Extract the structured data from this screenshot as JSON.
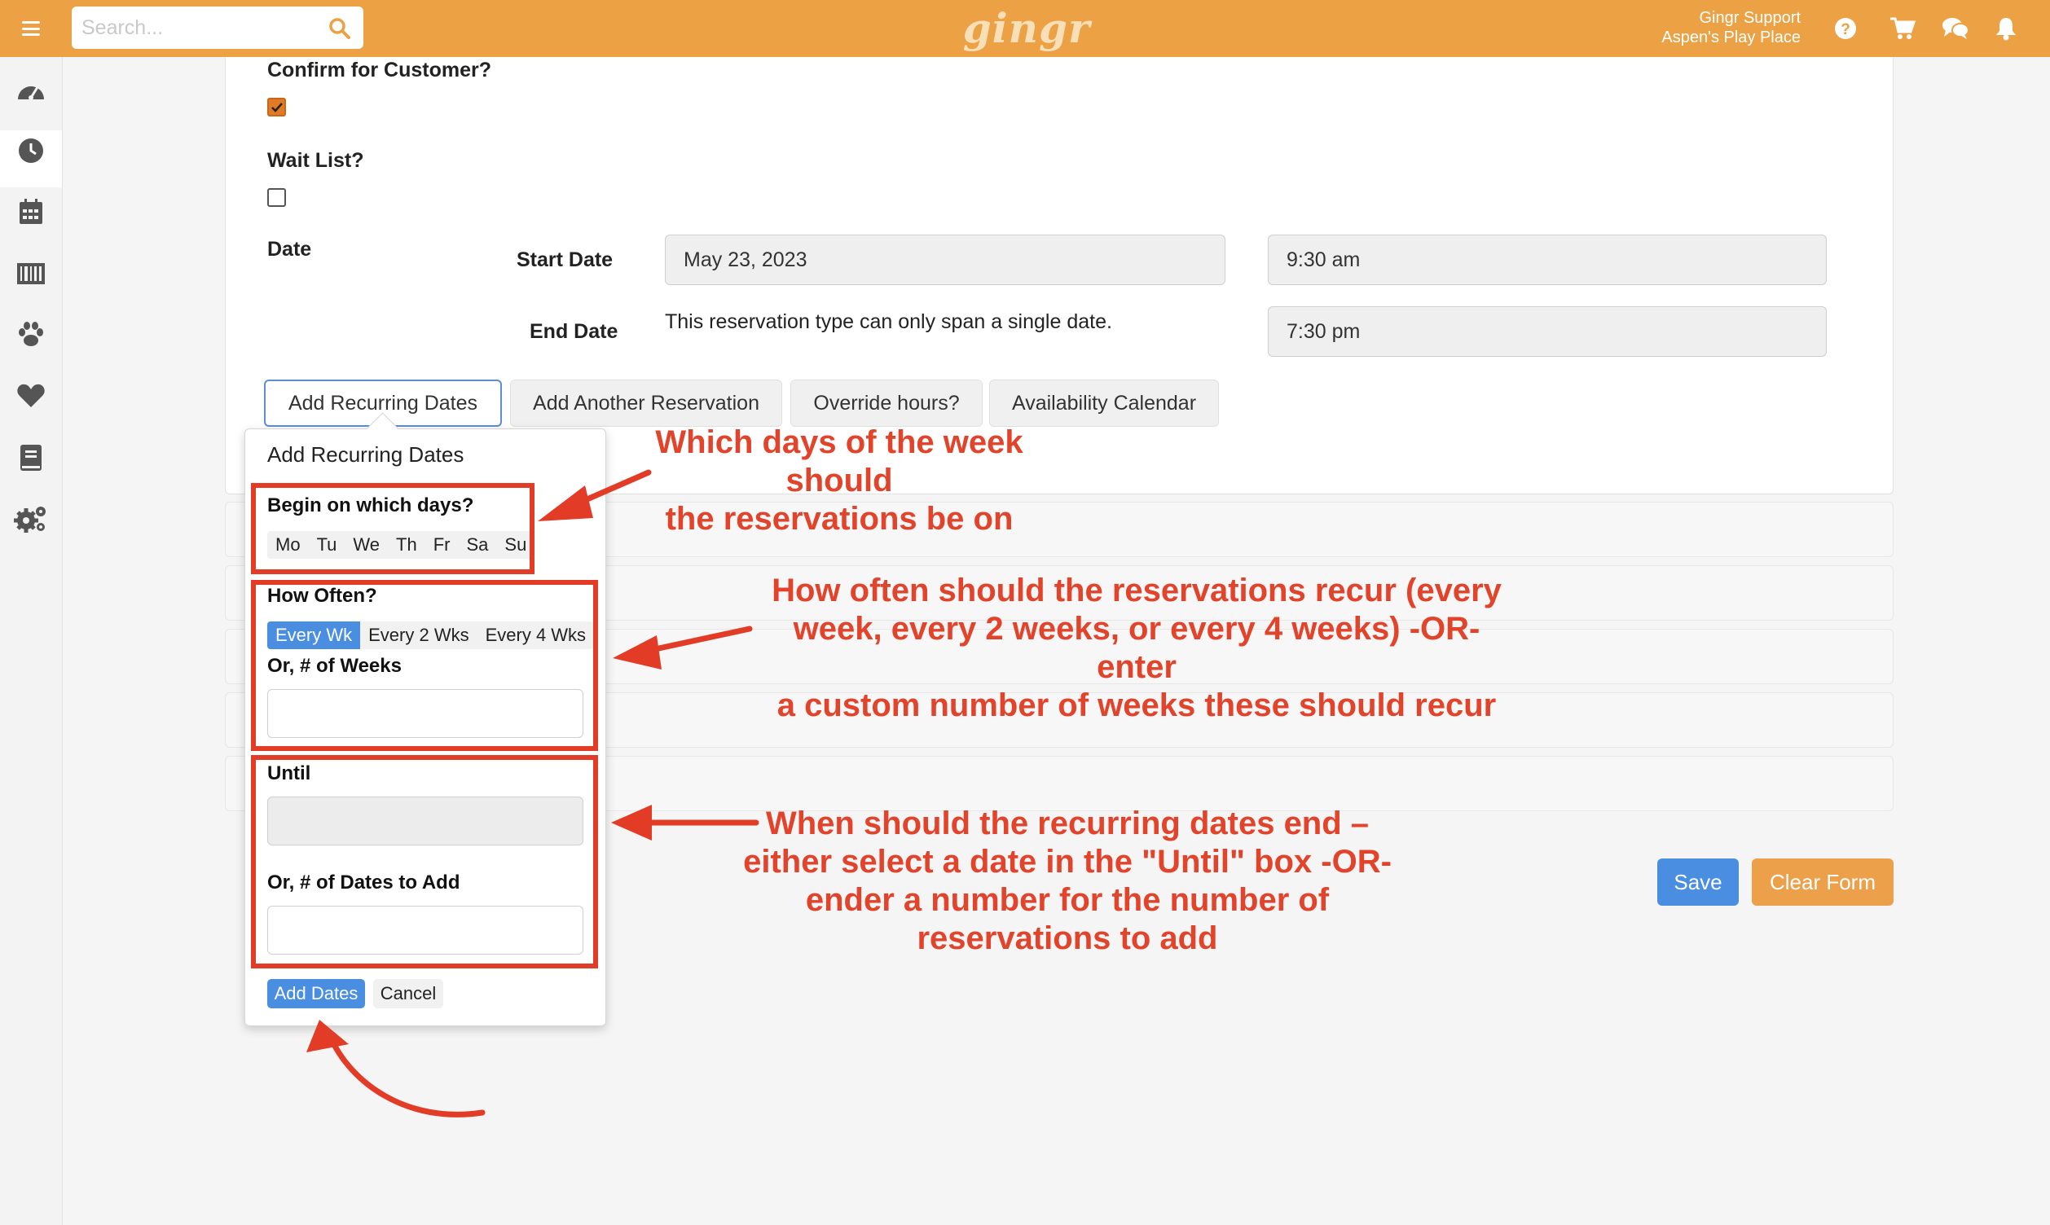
{
  "header": {
    "search_placeholder": "Search...",
    "logo": "gingr",
    "user_name": "Gingr Support",
    "location": "Aspen's Play Place",
    "icons": [
      "help-icon",
      "cart-icon",
      "chat-icon",
      "bell-icon"
    ]
  },
  "sidebar": {
    "items": [
      "dashboard-icon",
      "clock-icon",
      "calendar-icon",
      "barcode-icon",
      "paw-icon",
      "heart-icon",
      "book-icon",
      "gears-icon"
    ],
    "active": "clock-icon"
  },
  "form": {
    "confirm_label": "Confirm for Customer?",
    "confirm_checked": true,
    "waitlist_label": "Wait List?",
    "waitlist_checked": false,
    "date_label": "Date",
    "start_date_label": "Start Date",
    "start_date_value": "May 23, 2023",
    "start_time_value": "9:30 am",
    "end_date_label": "End Date",
    "end_date_note": "This reservation type can only span a single date.",
    "end_time_value": "7:30 pm",
    "tabs": [
      "Add Recurring Dates",
      "Add Another Reservation",
      "Override hours?",
      "Availability Calendar"
    ]
  },
  "popover": {
    "title": "Add Recurring Dates",
    "days_label": "Begin on which days?",
    "days": [
      "Mo",
      "Tu",
      "We",
      "Th",
      "Fr",
      "Sa",
      "Su"
    ],
    "how_often_label": "How Often?",
    "frequencies": [
      "Every Wk",
      "Every 2 Wks",
      "Every 4 Wks"
    ],
    "frequency_selected": "Every Wk",
    "weeks_label": "Or, # of Weeks",
    "until_label": "Until",
    "dates_label": "Or, # of Dates to Add",
    "add_button": "Add Dates",
    "cancel_button": "Cancel"
  },
  "actions": {
    "save": "Save",
    "clear": "Clear Form"
  },
  "annotations": {
    "days": [
      "Which days of the week should",
      "the reservations be on"
    ],
    "frequency": [
      "How often should the reservations recur (every",
      "week, every 2 weeks, or every 4 weeks) -OR- enter",
      "a custom number of weeks these should recur"
    ],
    "end": [
      "When should the recurring dates end –",
      "either select a date in the \"Until\" box -OR-",
      "ender a number for the number of",
      "reservations to add"
    ],
    "color": "#e23b26"
  },
  "colors": {
    "header": "#eca244",
    "primary": "#4a8ee2",
    "clear_button": "#eda04a"
  }
}
